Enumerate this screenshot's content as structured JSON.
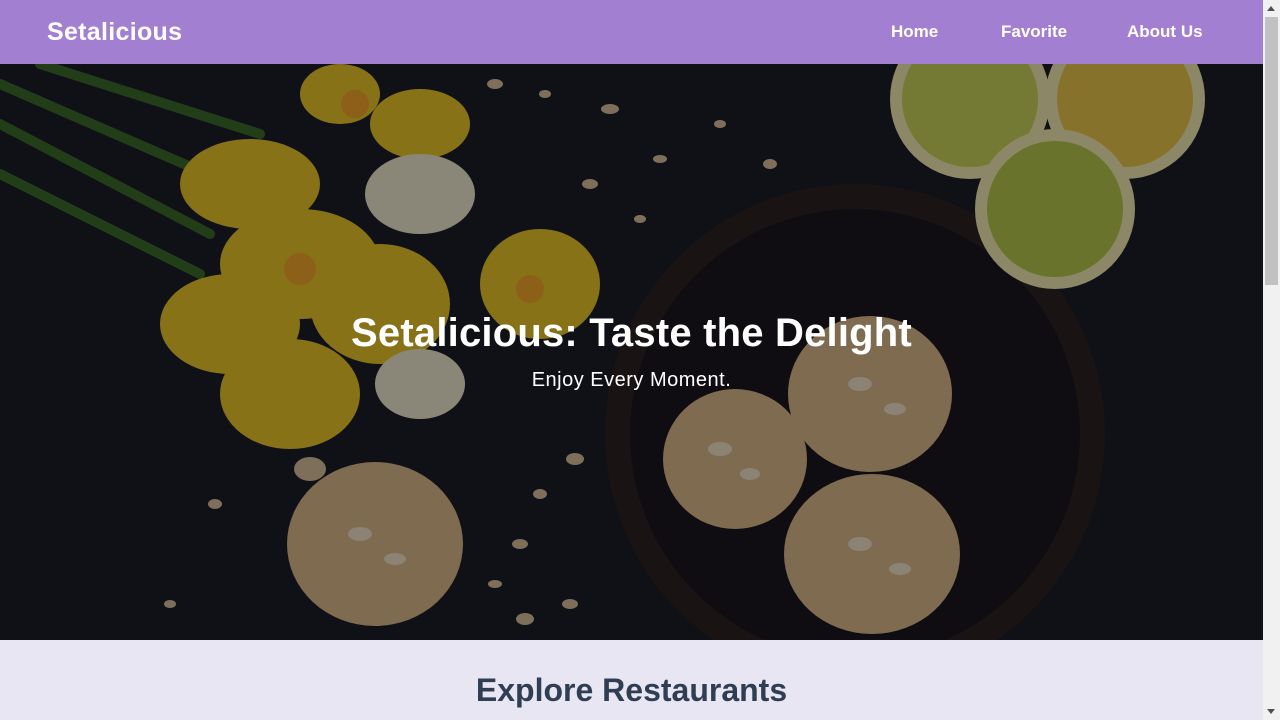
{
  "app": {
    "brand": "Setalicious"
  },
  "nav": {
    "items": [
      {
        "label": "Home"
      },
      {
        "label": "Favorite"
      },
      {
        "label": "About Us"
      }
    ]
  },
  "hero": {
    "title": "Setalicious: Taste the Delight",
    "subtitle": "Enjoy Every Moment."
  },
  "main": {
    "section_title": "Explore Restaurants"
  },
  "colors": {
    "navbar": "#a37fd1",
    "page_background": "#e8e6f2",
    "section_title": "#2f3e52",
    "hero_text": "#ffffff"
  }
}
